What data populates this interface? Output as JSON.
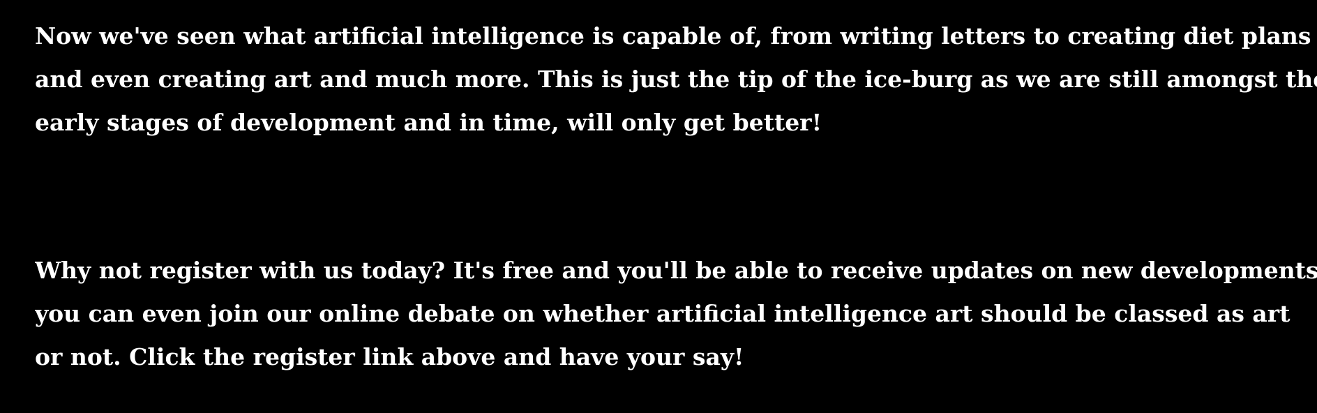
{
  "content": {
    "paragraph_1": {
      "lines": [
        "Now we've seen what artificial intelligence is capable of, from writing letters to creating diet plans",
        "and even creating art and much more. This is just the tip of the ice-burg as we are still amongst the",
        "early stages of development and in time, will only get better!"
      ]
    },
    "paragraph_2": {
      "lines": [
        "Why not register with us today? It's free and you'll be able to receive updates on new developments",
        "you can even join our online debate on whether artificial intelligence art should be classed as art",
        "or not. Click the register link above and have your say!"
      ]
    }
  },
  "colors": {
    "background": "#000000",
    "text": "#ffffff"
  }
}
